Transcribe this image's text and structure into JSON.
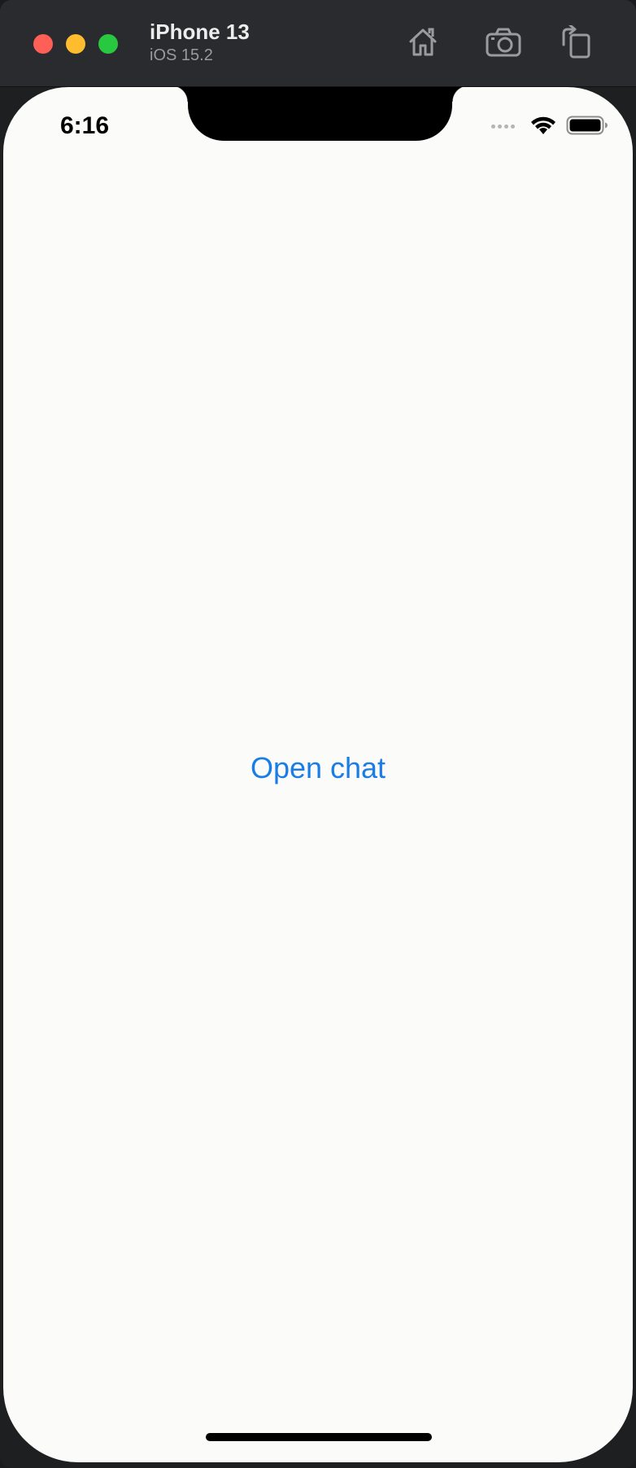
{
  "window": {
    "device_name": "iPhone 13",
    "device_os": "iOS 15.2",
    "toolbar": {
      "home_icon": "home-icon",
      "camera_icon": "screenshot-camera-icon",
      "rotate_icon": "rotate-device-icon"
    },
    "traffic_lights": {
      "close_color": "#fe5f57",
      "minimize_color": "#febc2e",
      "zoom_color": "#28c840"
    }
  },
  "status_bar": {
    "time": "6:16",
    "signal_icon": "cellular-signal-icon",
    "wifi_icon": "wifi-icon",
    "battery_icon": "battery-icon"
  },
  "main": {
    "open_chat_label": "Open chat",
    "accent_color": "#1a7de6"
  }
}
